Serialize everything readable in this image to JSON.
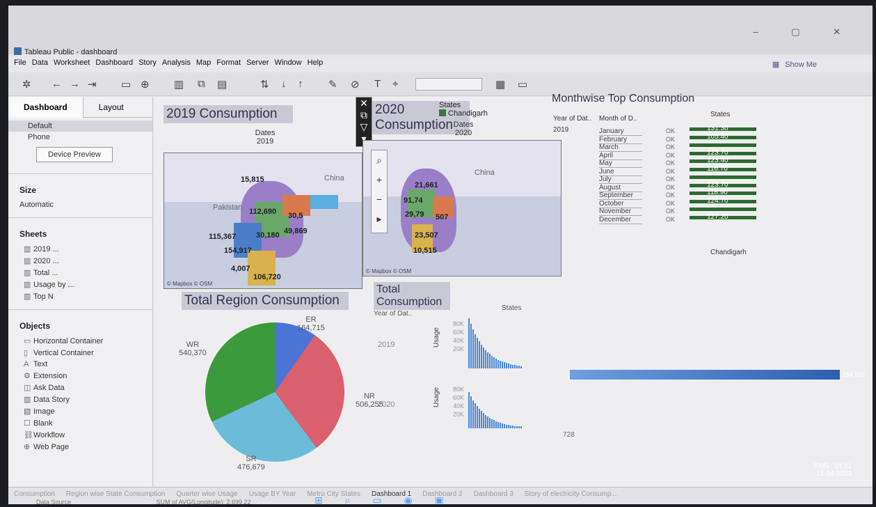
{
  "window": {
    "title": "Tableau Public - dashboard",
    "controls": "–  ▢  ✕"
  },
  "menu": [
    "File",
    "Data",
    "Worksheet",
    "Dashboard",
    "Story",
    "Analysis",
    "Map",
    "Format",
    "Server",
    "Window",
    "Help"
  ],
  "show_me": "Show Me",
  "left": {
    "tabs": [
      "Dashboard",
      "Layout"
    ],
    "devices": [
      "Default",
      "Phone"
    ],
    "device_preview": "Device Preview",
    "size_heading": "Size",
    "size_value": "Automatic",
    "sheets_heading": "Sheets",
    "sheets": [
      "2019 ...",
      "2020 ...",
      "Total ...",
      "Usage by ...",
      "Top N"
    ],
    "objects_heading": "Objects",
    "objects": [
      {
        "icon": "▭",
        "label": "Horizontal Container"
      },
      {
        "icon": "▯",
        "label": "Vertical Container"
      },
      {
        "icon": "A",
        "label": "Text"
      },
      {
        "icon": "⚙",
        "label": "Extension"
      },
      {
        "icon": "◫",
        "label": "Ask Data"
      },
      {
        "icon": "▥",
        "label": "Data Story"
      },
      {
        "icon": "▧",
        "label": "Image"
      },
      {
        "icon": "☐",
        "label": "Blank"
      },
      {
        "icon": "⛓",
        "label": "Workflow"
      },
      {
        "icon": "⊕",
        "label": "Web Page"
      }
    ]
  },
  "map2019": {
    "title": "2019 Consumption",
    "dates_label": "Dates",
    "dates_value": "2019",
    "labels": [
      "15,815",
      "112,690",
      "30,5",
      "115,367",
      "30,180",
      "49,869",
      "154,917",
      "4,007",
      "106,720"
    ],
    "country": "Pakistan",
    "china": "China",
    "copyright": "© Mapbox © OSM"
  },
  "map2020": {
    "title": "2020 Consumption",
    "legend_title": "States",
    "legend_item": "Chandigarh",
    "dates_label": "Dates",
    "dates_value": "2020",
    "labels": [
      "21,661",
      "91,74",
      "29,79",
      "507",
      "23,507",
      "10,515"
    ],
    "china": "China",
    "copyright": "© Mapbox © OSM"
  },
  "top_consumption": {
    "title": "Monthwise Top Consumption",
    "col_year": "Year of Dat..",
    "col_month": "Month of D..",
    "col_states": "States",
    "year": "2019",
    "footer": "Chandigarh",
    "rows": [
      {
        "month": "January",
        "ok": "OK",
        "value": "131.30"
      },
      {
        "month": "February",
        "ok": "OK",
        "value": "105.40"
      },
      {
        "month": "March",
        "ok": "OK",
        "value": ""
      },
      {
        "month": "April",
        "ok": "OK",
        "value": "123.70"
      },
      {
        "month": "May",
        "ok": "OK",
        "value": "123.40"
      },
      {
        "month": "June",
        "ok": "OK",
        "value": "116.70"
      },
      {
        "month": "July",
        "ok": "OK",
        "value": ""
      },
      {
        "month": "August",
        "ok": "OK",
        "value": "123.70"
      },
      {
        "month": "September",
        "ok": "OK",
        "value": "118.90"
      },
      {
        "month": "October",
        "ok": "OK",
        "value": "124.70"
      },
      {
        "month": "November",
        "ok": "OK",
        "value": ""
      },
      {
        "month": "December",
        "ok": "OK",
        "value": "127.20"
      }
    ]
  },
  "region": {
    "title": "Total Region Consumption",
    "slices": [
      {
        "name": "ER",
        "value": "164,715",
        "color": "#4a74d6"
      },
      {
        "name": "NR",
        "value": "506,255",
        "color": "#d9606c"
      },
      {
        "name": "SR",
        "value": "476,679",
        "color": "#6cbcd9"
      },
      {
        "name": "WR",
        "value": "540,370",
        "color": "#3b9a3b"
      }
    ]
  },
  "total": {
    "title": "Total Consumption",
    "col_year": "Year of Dat..",
    "col_states": "States",
    "rows": [
      {
        "year": "2019",
        "axis": "Usage"
      },
      {
        "year": "2020",
        "axis": "Usage"
      }
    ],
    "ticks": [
      "80K",
      "60K",
      "40K",
      "20K"
    ],
    "small_value": "728",
    "big_value": "154,917"
  },
  "sheet_tabs": [
    {
      "label": "Consumption",
      "active": false
    },
    {
      "label": "Region wise State Consumption",
      "active": false
    },
    {
      "label": "Quarter wise Usage",
      "active": false
    },
    {
      "label": "Usage BY Year",
      "active": false
    },
    {
      "label": "Metro City States",
      "active": false
    },
    {
      "label": "Dashboard 1",
      "active": true
    },
    {
      "label": "Dashboard 2",
      "active": false
    },
    {
      "label": "Dashboard 3",
      "active": false
    },
    {
      "label": "Story of electricity Consump...",
      "active": false
    }
  ],
  "status": {
    "data_source": "Data Source",
    "sum": "SUM of AVG(Longitude): 2,699.22"
  },
  "taskbar": {
    "lang": "ENG",
    "time": "01:11",
    "date": "13-04-2023"
  }
}
